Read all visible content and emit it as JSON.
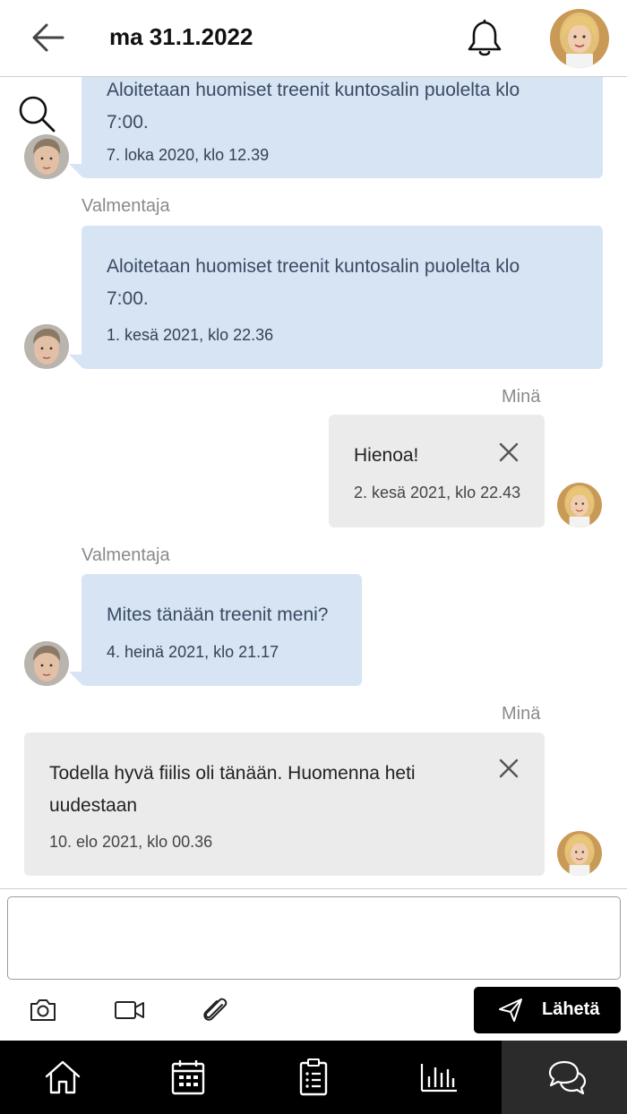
{
  "header": {
    "date": "ma 31.1.2022",
    "back_icon": "arrow-left-icon",
    "notification_icon": "bell-icon"
  },
  "chat": {
    "search_icon": "search-icon",
    "messages": [
      {
        "from": "coach",
        "sender": "",
        "text_line1": "Aloitetaan huomiset treenit kuntosalin puolelta klo",
        "text_line2": "7:00.",
        "time": "7. loka 2020, klo 12.39"
      },
      {
        "from": "coach",
        "sender": "Valmentaja",
        "text_line1": "Aloitetaan huomiset treenit kuntosalin puolelta klo",
        "text_line2": "7:00.",
        "time": "1. kesä 2021, klo 22.36"
      },
      {
        "from": "me",
        "sender": "Minä",
        "text_line1": "Hienoa!",
        "text_line2": "",
        "time": "2. kesä 2021, klo 22.43"
      },
      {
        "from": "coach",
        "sender": "Valmentaja",
        "text_line1": "Mites tänään treenit meni?",
        "text_line2": "",
        "time": "4. heinä 2021, klo 21.17"
      },
      {
        "from": "me",
        "sender": "Minä",
        "text_line1": "Todella hyvä fiilis oli tänään. Huomenna heti",
        "text_line2": "uudestaan",
        "time": "10. elo 2021, klo 00.36"
      }
    ]
  },
  "composer": {
    "input_value": "",
    "input_placeholder": "",
    "send_label": "Lähetä",
    "tools": [
      "camera-icon",
      "video-icon",
      "paperclip-icon"
    ]
  },
  "nav": {
    "items": [
      "home-icon",
      "calendar-icon",
      "clipboard-list-icon",
      "bar-chart-icon",
      "chat-icon"
    ],
    "active": "chat-icon"
  },
  "colors": {
    "coach_bubble": "#d6e4f4",
    "me_bubble": "#ebebeb",
    "nav_bg": "#000000",
    "send_bg": "#000000"
  }
}
